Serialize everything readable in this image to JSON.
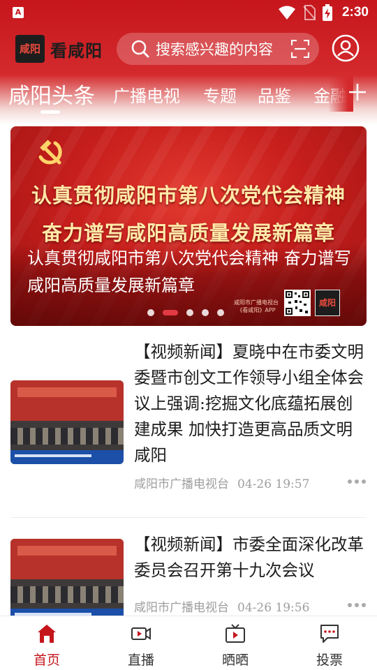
{
  "status_bar": {
    "app_icon": "A",
    "time": "2:30",
    "icons": [
      "wifi-icon",
      "no-sim-icon",
      "battery-charging-icon"
    ]
  },
  "header": {
    "logo_seal_text": "咸阳",
    "logo_text": "看咸阳",
    "search": {
      "placeholder": "搜索感兴趣的内容",
      "icon": "search-icon",
      "scan_icon": "scan-icon"
    },
    "profile_icon": "user-icon"
  },
  "channels": {
    "items": [
      "咸阳头条",
      "广播电视",
      "专题",
      "品鉴",
      "金融"
    ],
    "active_index": 0,
    "add_icon": "plus-icon"
  },
  "banner": {
    "headline_line1": "认真贯彻咸阳市第八次党代会精神",
    "headline_line2": "奋力谱写咸阳高质量发展新篇章",
    "caption": "认真贯彻咸阳市第八次党代会精神 奋力谱写咸阳高质量发展新篇章",
    "source_line1": "咸阳市广播电视台",
    "source_line2": "《看咸阳》APP",
    "seal_text": "咸阳",
    "dots_total": 5,
    "active_dot": 1
  },
  "news": [
    {
      "title": "【视频新闻】夏晓中在市委文明委暨市创文工作领导小组全体会议上强调:挖掘文化底蕴拓展创建成果 加快打造更高品质文明咸阳",
      "source": "咸阳市广播电视台",
      "time": "04-26 19:57"
    },
    {
      "title": "【视频新闻】市委全面深化改革委员会召开第十九次会议",
      "source": "咸阳市广播电视台",
      "time": "04-26 19:56"
    }
  ],
  "bottom_nav": {
    "items": [
      {
        "label": "首页",
        "icon": "home-icon"
      },
      {
        "label": "直播",
        "icon": "video-camera-icon"
      },
      {
        "label": "晒晒",
        "icon": "tv-icon"
      },
      {
        "label": "投票",
        "icon": "chat-bubble-icon"
      }
    ],
    "active_index": 0
  },
  "colors": {
    "brand_red": "#c5161c",
    "active_dot": "#e23a44",
    "meta_gray": "#9e9e9e"
  }
}
